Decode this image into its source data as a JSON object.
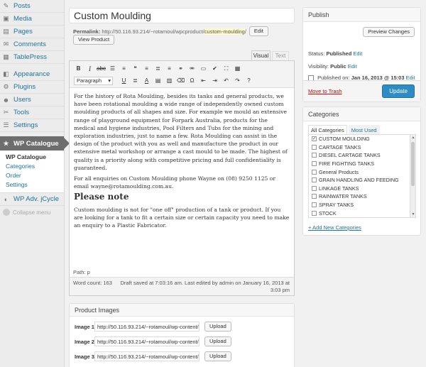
{
  "sidebar": {
    "items": [
      {
        "label": "Posts",
        "icon": "pin-icon",
        "glyph": "✎"
      },
      {
        "label": "Media",
        "icon": "media-icon",
        "glyph": "▣"
      },
      {
        "label": "Pages",
        "icon": "pages-icon",
        "glyph": "▤"
      },
      {
        "label": "Comments",
        "icon": "comment-icon",
        "glyph": "✉"
      },
      {
        "label": "TablePress",
        "icon": "table-icon",
        "glyph": "▦"
      },
      {
        "label": "Appearance",
        "icon": "appearance-icon",
        "glyph": "◧"
      },
      {
        "label": "Plugins",
        "icon": "plugin-icon",
        "glyph": "⚙"
      },
      {
        "label": "Users",
        "icon": "users-icon",
        "glyph": "☻"
      },
      {
        "label": "Tools",
        "icon": "tools-icon",
        "glyph": "✂"
      },
      {
        "label": "Settings",
        "icon": "settings-icon",
        "glyph": "☰"
      }
    ],
    "active": {
      "label": "WP Catalogue",
      "glyph": "★"
    },
    "submenu": [
      "WP Catalogue",
      "Categories",
      "Order",
      "Settings"
    ],
    "extra": {
      "label": "WP Adv. jCycle",
      "glyph": "◐"
    },
    "collapse": "Collapse menu"
  },
  "post": {
    "title": "Custom Moulding",
    "permalink_label": "Permalink:",
    "permalink_base": "http://50.116.93.214/~rotamoul/wpcproduct/",
    "permalink_slug": "custom-moulding",
    "permalink_end": "/",
    "edit_label": "Edit",
    "view_label": "View Product"
  },
  "editor": {
    "tab_visual": "Visual",
    "tab_text": "Text",
    "format": "Paragraph",
    "para1": "For the history of Rota Moulding, besides its tanks and general products, we have been rotational moulding a wide range of independently owned custom moulding products of all shapes and size. For example we mould an extensive range of playground equipment for Forpark Australia, products for the medical and hygiene industries, Pool Filters and Tubs for the mining and exploration industries, just to name a few. Rota Moulding can assist in the design of the product with you as well and manufacture the product in our extensive metal workshop or arrange a cast mould to be made. The highest of quality is a priority along with competitive pricing and full confidentiality is guaranteed.",
    "para2": "For all enquiries on Custom Moulding phone Wayne on (08) 9250 1125 or email wayne@rotamoulding.com.au.",
    "heading": "Please note",
    "para3": "Custom moulding is not for \"one off\" production of a tank or product. If you are looking for a tank to fit a certain size or certain capacity you need to make an enquiry to a Plastic Fabricator.",
    "path": "Path: p",
    "word_count": "Word count: 163",
    "draft": "Draft saved at 7:03:16 am. Last edited by admin on January 16, 2013 at 3:03 pm"
  },
  "images_box": {
    "title": "Product Images",
    "rows": [
      {
        "label": "Image 1",
        "value": "http://50.116.93.214/~rotamoul/wp-content/upl",
        "button": "Upload"
      },
      {
        "label": "Image 2",
        "value": "http://50.116.93.214/~rotamoul/wp-content/upl",
        "button": "Upload"
      },
      {
        "label": "Image 3",
        "value": "http://50.116.93.214/~rotamoul/wp-content/upl",
        "button": "Upload"
      }
    ]
  },
  "publish": {
    "title": "Publish",
    "preview": "Preview Changes",
    "status_label": "Status:",
    "status_value": "Published",
    "visibility_label": "Visibility:",
    "visibility_value": "Public",
    "published_label": "Published on:",
    "published_value": "Jan 16, 2013 @ 15:03",
    "edit": "Edit",
    "trash": "Move to Trash",
    "update": "Update"
  },
  "categories": {
    "title": "Categories",
    "tab_all": "All Categories",
    "tab_used": "Most Used",
    "items": [
      {
        "label": "CUSTOM MOULDING",
        "checked": "✓"
      },
      {
        "label": "CARTAGE TANKS",
        "checked": ""
      },
      {
        "label": "DIESEL CARTAGE TANKS",
        "checked": ""
      },
      {
        "label": "FIRE FIGHTING TANKS",
        "checked": ""
      },
      {
        "label": "General Products",
        "checked": ""
      },
      {
        "label": "GRAIN HANDLING AND FEEDING",
        "checked": ""
      },
      {
        "label": "LINKAGE TANKS",
        "checked": ""
      },
      {
        "label": "RAINWATER TANKS",
        "checked": ""
      },
      {
        "label": "SPRAY TANKS",
        "checked": ""
      },
      {
        "label": "STOCK",
        "checked": ""
      }
    ],
    "add": "+ Add New Categories"
  }
}
